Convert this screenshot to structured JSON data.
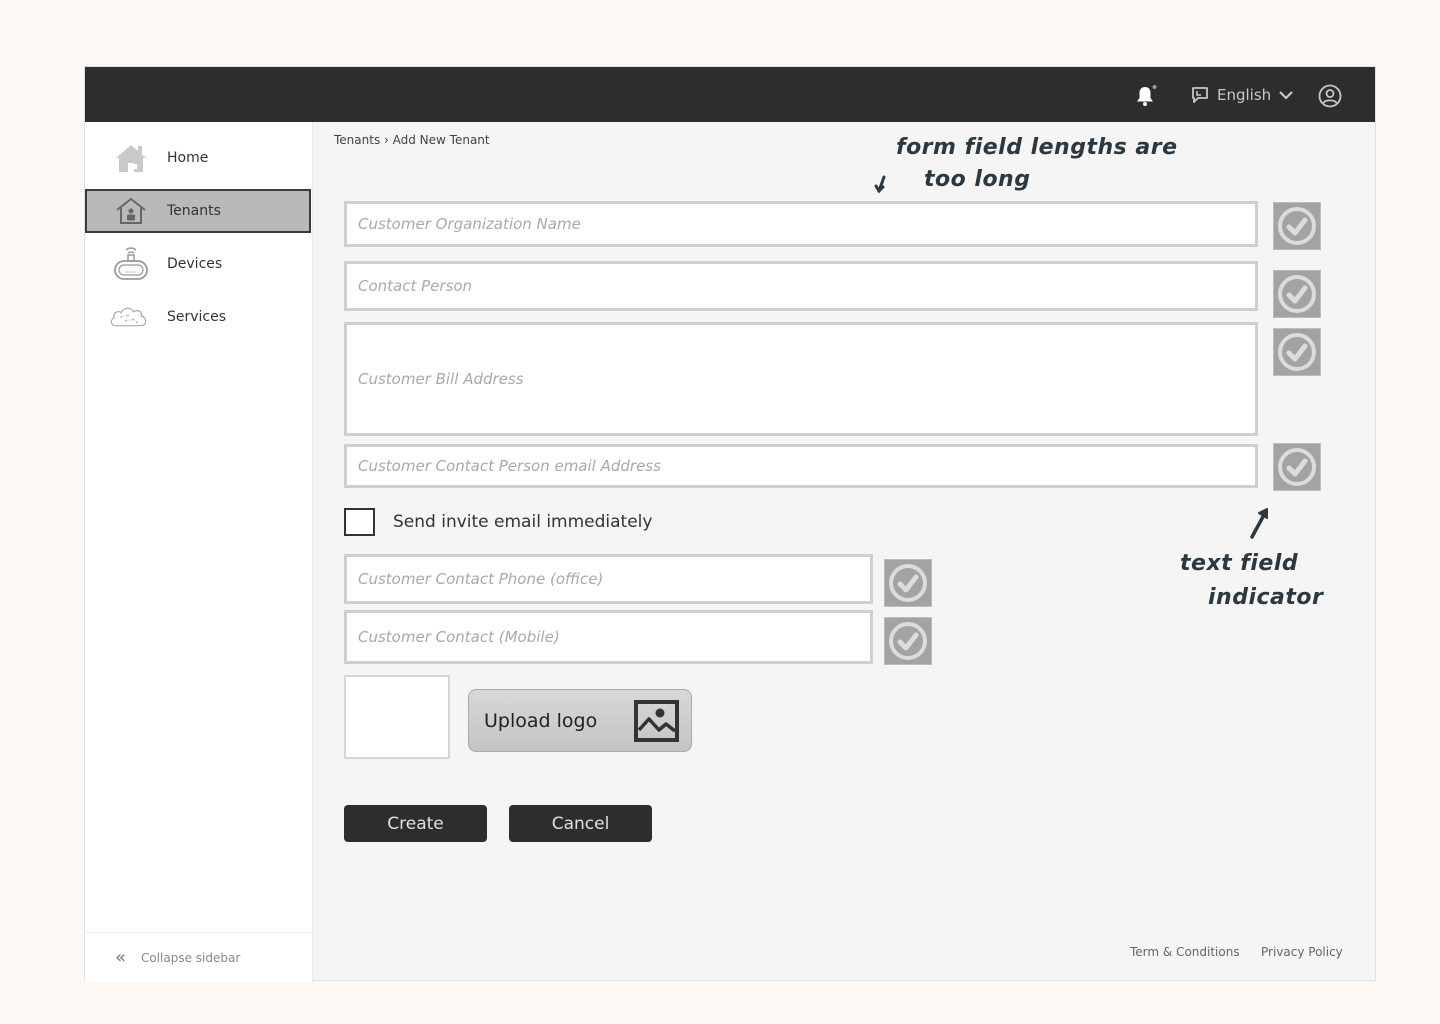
{
  "topbar": {
    "notification_icon": "bell-icon",
    "language": {
      "icon": "chat-bubble-icon",
      "label": "English",
      "chevron": "chevron-down-icon"
    },
    "user_icon": "user-circle-icon"
  },
  "sidebar": {
    "items": [
      {
        "label": "Home",
        "icon": "home-icon",
        "active": false
      },
      {
        "label": "Tenants",
        "icon": "tenant-house-icon",
        "active": true
      },
      {
        "label": "Devices",
        "icon": "router-device-icon",
        "active": false
      },
      {
        "label": "Services",
        "icon": "cloud-network-icon",
        "active": false
      }
    ],
    "collapse": {
      "icon": "double-chevron-left-icon",
      "glyph": "«",
      "label": "Collapse sidebar"
    }
  },
  "breadcrumb": "Tenants › Add New Tenant",
  "annotations": {
    "top": {
      "line1": "form field lengths are",
      "line2": "too long"
    },
    "bottom": {
      "line1": "text field",
      "line2": "indicator"
    }
  },
  "form": {
    "fields": [
      {
        "placeholder": "Customer Organization Name",
        "value": "",
        "indicator": "check-circle-icon"
      },
      {
        "placeholder": "Contact Person",
        "value": "",
        "indicator": "check-circle-icon"
      },
      {
        "placeholder": "Customer Bill Address",
        "value": "",
        "indicator": "check-circle-icon"
      },
      {
        "placeholder": "Customer Contact Person email Address",
        "value": "",
        "indicator": "check-circle-icon"
      },
      {
        "placeholder": "Customer Contact Phone (office)",
        "value": "",
        "indicator": "check-circle-icon"
      },
      {
        "placeholder": "Customer Contact (Mobile)",
        "value": "",
        "indicator": "check-circle-icon"
      }
    ],
    "invite_checkbox": {
      "label": "Send invite email immediately",
      "checked": false
    },
    "upload": {
      "label": "Upload logo",
      "icon": "image-icon"
    },
    "create_label": "Create",
    "cancel_label": "Cancel"
  },
  "footer": {
    "terms": "Term & Conditions",
    "privacy": "Privacy Policy"
  }
}
